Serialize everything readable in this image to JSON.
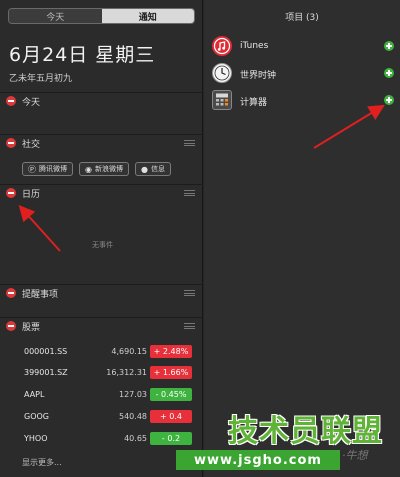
{
  "tabs": {
    "today": "今天",
    "notifications": "通知"
  },
  "date": {
    "title": "6月24日 星期三",
    "lunar": "乙未年五月初九"
  },
  "sections": {
    "today": "今天",
    "social": "社交",
    "calendar": "日历",
    "reminders": "提醒事项",
    "stocks": "股票"
  },
  "social": {
    "tencent": "腾讯微博",
    "sina": "新浪微博",
    "message": "信息"
  },
  "calendar": {
    "no_events": "无事件"
  },
  "stocks": {
    "rows": [
      {
        "symbol": "000001.SS",
        "price": "4,690.15",
        "change": "+ 2.48%",
        "dir": "up"
      },
      {
        "symbol": "399001.SZ",
        "price": "16,312.31",
        "change": "+ 1.66%",
        "dir": "up"
      },
      {
        "symbol": "AAPL",
        "price": "127.03",
        "change": "- 0.45%",
        "dir": "down"
      },
      {
        "symbol": "GOOG",
        "price": "540.48",
        "change": "+ 0.4",
        "dir": "up"
      },
      {
        "symbol": "YHOO",
        "price": "40.65",
        "change": "- 0.2",
        "dir": "down"
      }
    ],
    "more": "显示更多..."
  },
  "items": {
    "header": "项目 (3)",
    "list": [
      {
        "name": "iTunes",
        "icon": "itunes-icon"
      },
      {
        "name": "世界时钟",
        "icon": "clock-icon"
      },
      {
        "name": "计算器",
        "icon": "calculator-icon"
      }
    ]
  },
  "watermark": {
    "brand": "技术员联盟",
    "url": "www.jsgho.com",
    "tag": "·牛想"
  },
  "colors": {
    "up": "#e8303a",
    "down": "#3fb33f",
    "remove": "#d93a3a",
    "add": "#3fb33f",
    "brand": "#3aa531"
  }
}
